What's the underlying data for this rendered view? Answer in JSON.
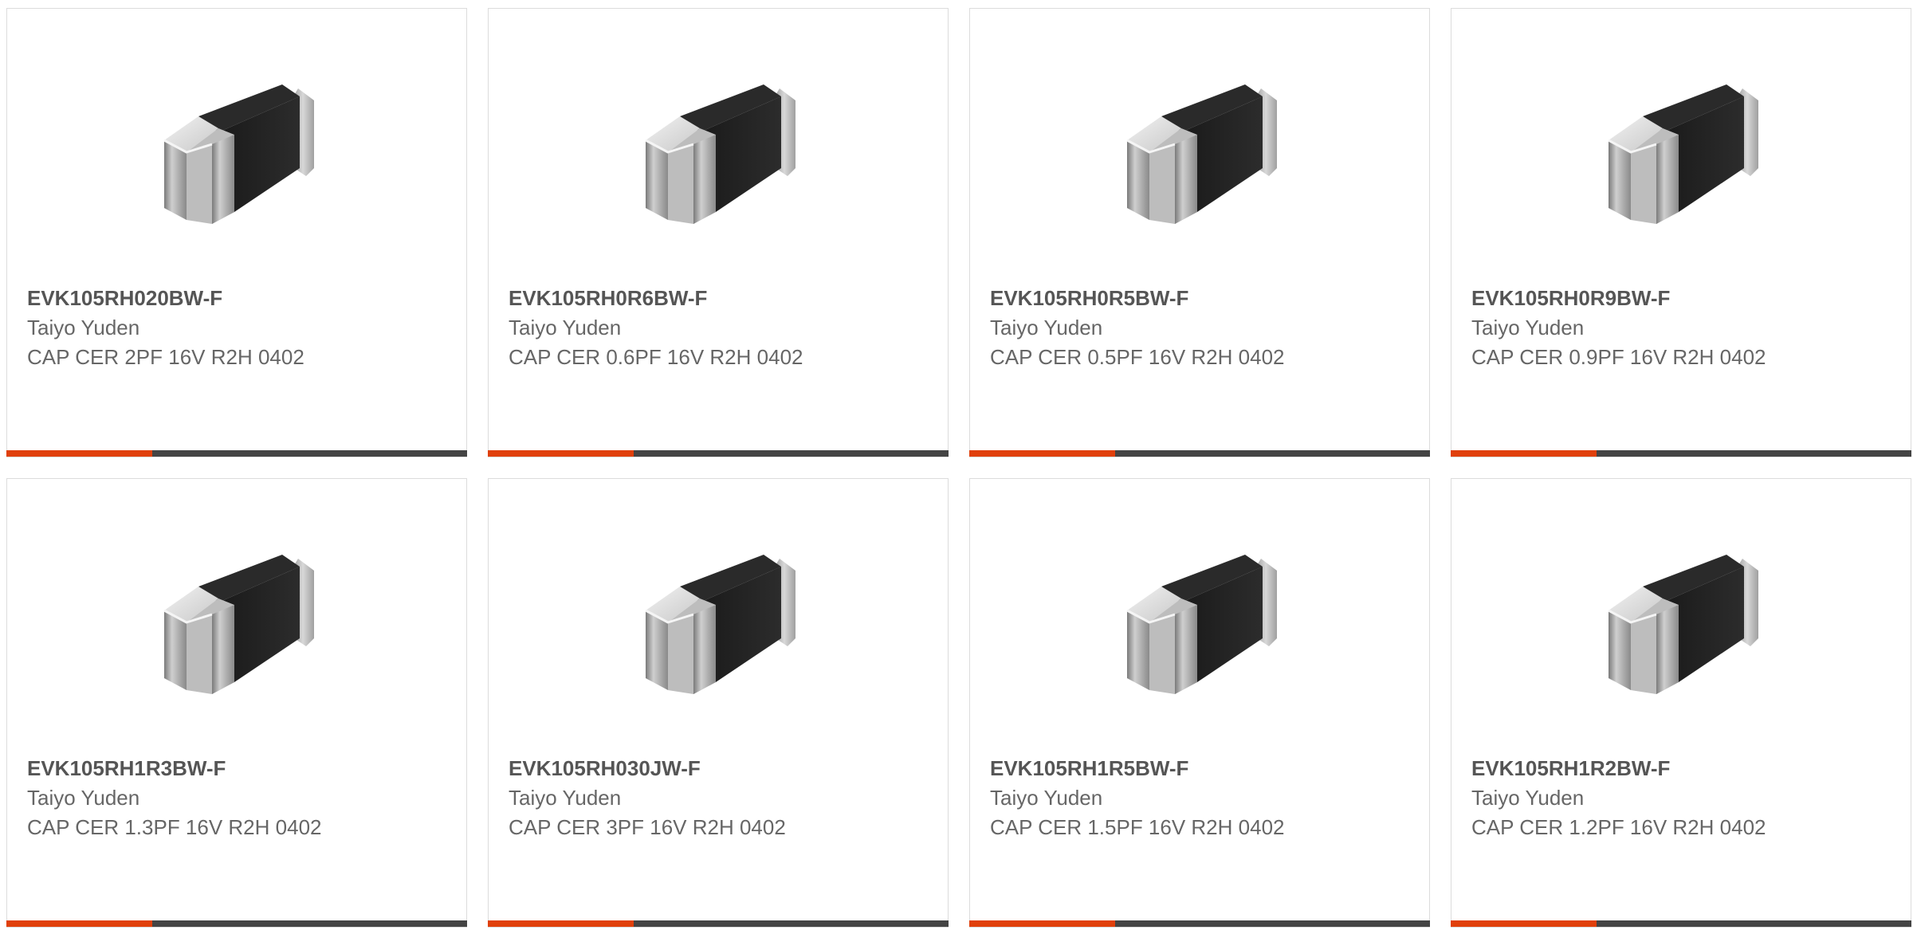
{
  "colors": {
    "accent": "#e0400b",
    "bar_dark": "#444444",
    "border": "#dcdcdc",
    "part_text": "#555555",
    "body_text": "#666666"
  },
  "products": [
    {
      "part_number": "EVK105RH020BW-F",
      "manufacturer": "Taiyo Yuden",
      "description": "CAP CER 2PF 16V R2H 0402",
      "image": "chip-capacitor-0402-image"
    },
    {
      "part_number": "EVK105RH0R6BW-F",
      "manufacturer": "Taiyo Yuden",
      "description": "CAP CER 0.6PF 16V R2H 0402",
      "image": "chip-capacitor-0402-image"
    },
    {
      "part_number": "EVK105RH0R5BW-F",
      "manufacturer": "Taiyo Yuden",
      "description": "CAP CER 0.5PF 16V R2H 0402",
      "image": "chip-capacitor-0402-image"
    },
    {
      "part_number": "EVK105RH0R9BW-F",
      "manufacturer": "Taiyo Yuden",
      "description": "CAP CER 0.9PF 16V R2H 0402",
      "image": "chip-capacitor-0402-image"
    },
    {
      "part_number": "EVK105RH1R3BW-F",
      "manufacturer": "Taiyo Yuden",
      "description": "CAP CER 1.3PF 16V R2H 0402",
      "image": "chip-capacitor-0402-image"
    },
    {
      "part_number": "EVK105RH030JW-F",
      "manufacturer": "Taiyo Yuden",
      "description": "CAP CER 3PF 16V R2H 0402",
      "image": "chip-capacitor-0402-image"
    },
    {
      "part_number": "EVK105RH1R5BW-F",
      "manufacturer": "Taiyo Yuden",
      "description": "CAP CER 1.5PF 16V R2H 0402",
      "image": "chip-capacitor-0402-image"
    },
    {
      "part_number": "EVK105RH1R2BW-F",
      "manufacturer": "Taiyo Yuden",
      "description": "CAP CER 1.2PF 16V R2H 0402",
      "image": "chip-capacitor-0402-image"
    }
  ]
}
